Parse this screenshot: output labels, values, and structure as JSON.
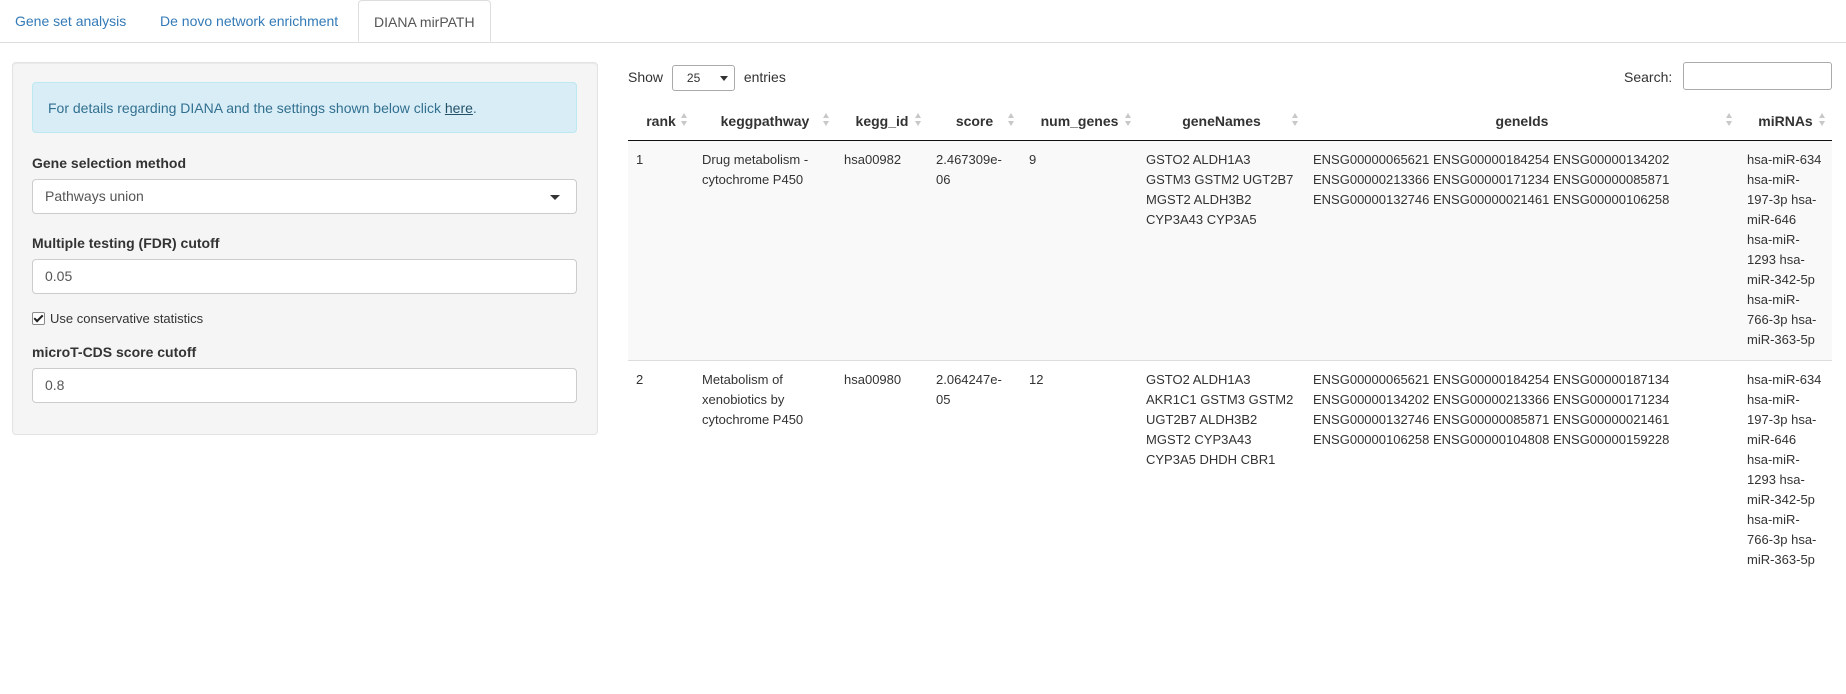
{
  "tabs": [
    "Gene set analysis",
    "De novo network enrichment",
    "DIANA mirPATH"
  ],
  "sidebar": {
    "alert_text": "For details regarding DIANA and the settings shown below click ",
    "alert_link": "here",
    "alert_end": ".",
    "gene_selection_label": "Gene selection method",
    "gene_selection_value": "Pathways union",
    "fdr_label": "Multiple testing (FDR) cutoff",
    "fdr_value": "0.05",
    "conservative_label": "Use conservative statistics",
    "conservative_checked": true,
    "microt_label": "microT-CDS score cutoff",
    "microt_value": "0.8"
  },
  "table_controls": {
    "show_label": "Show",
    "entries_value": "25",
    "entries_label": "entries",
    "search_label": "Search:"
  },
  "columns": [
    "rank",
    "keggpathway",
    "kegg_id",
    "score",
    "num_genes",
    "geneNames",
    "geneIds",
    "miRNAs"
  ],
  "rows": [
    {
      "rank": "1",
      "keggpathway": "Drug metabolism - cytochrome P450",
      "kegg_id": "hsa00982",
      "score": "2.467309e-06",
      "num_genes": "9",
      "geneNames": "GSTO2 ALDH1A3 GSTM3 GSTM2 UGT2B7 MGST2 ALDH3B2 CYP3A43 CYP3A5",
      "geneIds": "ENSG00000065621 ENSG00000184254 ENSG00000134202 ENSG00000213366 ENSG00000171234 ENSG00000085871 ENSG00000132746 ENSG00000021461 ENSG00000106258",
      "miRNAs": "hsa-miR-634 hsa-miR-197-3p hsa-miR-646 hsa-miR-1293 hsa-miR-342-5p hsa-miR-766-3p hsa-miR-363-5p"
    },
    {
      "rank": "2",
      "keggpathway": "Metabolism of xenobiotics by cytochrome P450",
      "kegg_id": "hsa00980",
      "score": "2.064247e-05",
      "num_genes": "12",
      "geneNames": "GSTO2 ALDH1A3 AKR1C1 GSTM3 GSTM2 UGT2B7 ALDH3B2 MGST2 CYP3A43 CYP3A5 DHDH CBR1",
      "geneIds": "ENSG00000065621 ENSG00000184254 ENSG00000187134 ENSG00000134202 ENSG00000213366 ENSG00000171234 ENSG00000132746 ENSG00000085871 ENSG00000021461 ENSG00000106258 ENSG00000104808 ENSG00000159228",
      "miRNAs": "hsa-miR-634 hsa-miR-197-3p hsa-miR-646 hsa-miR-1293 hsa-miR-342-5p hsa-miR-766-3p hsa-miR-363-5p"
    }
  ]
}
